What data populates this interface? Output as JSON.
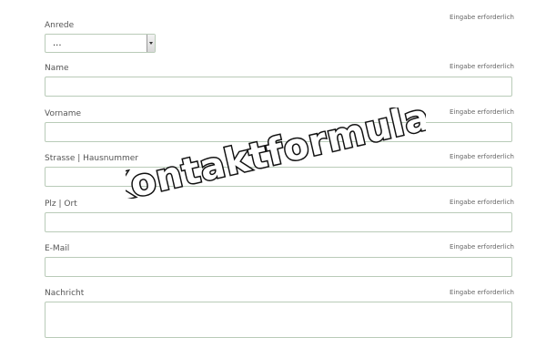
{
  "form": {
    "required_text": "Eingabe erforderlich",
    "fields": [
      {
        "label": "Anrede",
        "type": "select",
        "value": "..."
      },
      {
        "label": "Name",
        "type": "text",
        "value": ""
      },
      {
        "label": "Vorname",
        "type": "text",
        "value": ""
      },
      {
        "label": "Strasse | Hausnummer",
        "type": "text",
        "value": ""
      },
      {
        "label": "Plz | Ort",
        "type": "text",
        "value": ""
      },
      {
        "label": "E-Mail",
        "type": "text",
        "value": ""
      },
      {
        "label": "Nachricht",
        "type": "textarea",
        "value": ""
      }
    ]
  },
  "overlay": {
    "title": "Kontaktformular"
  },
  "colors": {
    "field_border": "#b9cbb8",
    "label_text": "#555555"
  }
}
